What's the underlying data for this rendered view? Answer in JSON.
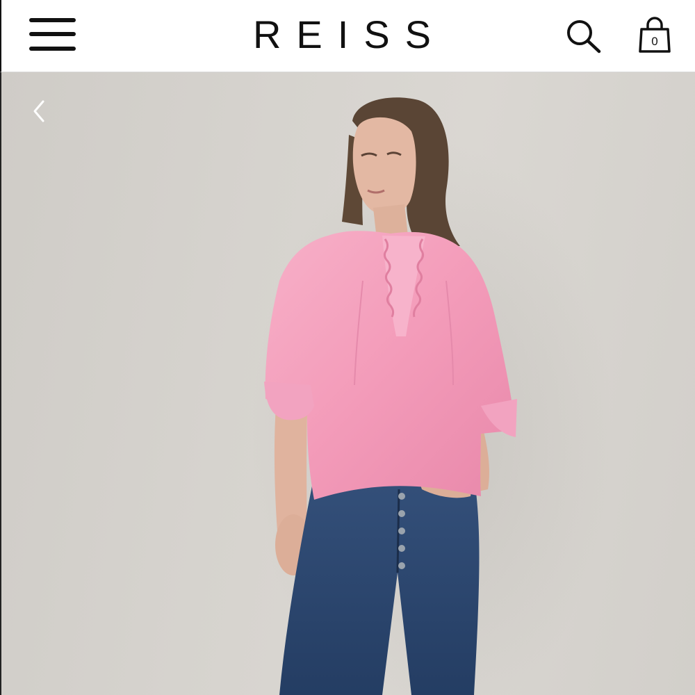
{
  "header": {
    "brand": "REISS",
    "bag_count": "0"
  },
  "icons": {
    "menu": "menu-icon",
    "search": "search-icon",
    "bag": "shopping-bag-icon",
    "back": "chevron-left-icon"
  },
  "colors": {
    "text": "#111111",
    "background": "#ffffff",
    "photo_background": "#d6d3ce",
    "blouse": "#f49ab9",
    "jeans": "#2e4a72"
  }
}
